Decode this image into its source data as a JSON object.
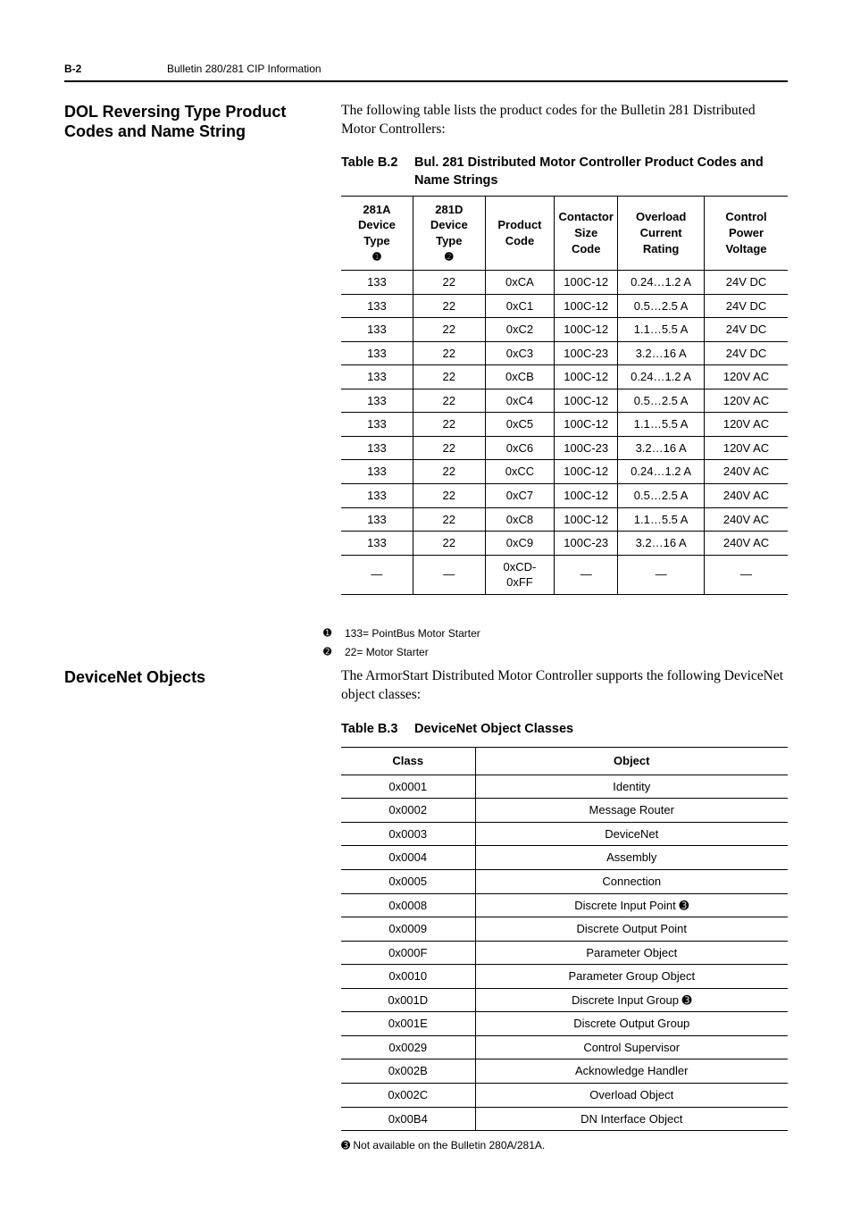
{
  "header": {
    "page": "B-2",
    "title": "Bulletin 280/281 CIP Information"
  },
  "section1": {
    "heading": "DOL Reversing Type Product Codes and Name String",
    "intro": "The following table lists the product codes for the Bulletin 281 Distributed Motor Controllers:",
    "tableCaptionNum": "Table B.2",
    "tableCaptionTxt": "Bul. 281 Distributed Motor Controller Product Codes and Name Strings",
    "headers": {
      "c0a": "281A",
      "c0b": "Device Type",
      "c0c": "➊",
      "c1a": "281D",
      "c1b": "Device Type",
      "c1c": "➋",
      "c2a": "Product",
      "c2b": "Code",
      "c3a": "Contactor",
      "c3b": "Size Code",
      "c4a": "Overload",
      "c4b": "Current Rating",
      "c5a": "Control Power",
      "c5b": "Voltage"
    },
    "rows": [
      [
        "133",
        "22",
        "0xCA",
        "100C-12",
        "0.24…1.2 A",
        "24V DC"
      ],
      [
        "133",
        "22",
        "0xC1",
        "100C-12",
        "0.5…2.5 A",
        "24V DC"
      ],
      [
        "133",
        "22",
        "0xC2",
        "100C-12",
        "1.1…5.5 A",
        "24V DC"
      ],
      [
        "133",
        "22",
        "0xC3",
        "100C-23",
        "3.2…16 A",
        "24V DC"
      ],
      [
        "133",
        "22",
        "0xCB",
        "100C-12",
        "0.24…1.2 A",
        "120V AC"
      ],
      [
        "133",
        "22",
        "0xC4",
        "100C-12",
        "0.5…2.5 A",
        "120V AC"
      ],
      [
        "133",
        "22",
        "0xC5",
        "100C-12",
        "1.1…5.5 A",
        "120V AC"
      ],
      [
        "133",
        "22",
        "0xC6",
        "100C-23",
        "3.2…16 A",
        "120V AC"
      ],
      [
        "133",
        "22",
        "0xCC",
        "100C-12",
        "0.24…1.2 A",
        "240V AC"
      ],
      [
        "133",
        "22",
        "0xC7",
        "100C-12",
        "0.5…2.5 A",
        "240V AC"
      ],
      [
        "133",
        "22",
        "0xC8",
        "100C-12",
        "1.1…5.5 A",
        "240V AC"
      ],
      [
        "133",
        "22",
        "0xC9",
        "100C-23",
        "3.2…16 A",
        "240V AC"
      ],
      [
        "—",
        "—",
        "0xCD-0xFF",
        "—",
        "—",
        "—"
      ]
    ],
    "fn1mark": "➊",
    "fn1text": "133= PointBus Motor Starter",
    "fn2mark": "➋",
    "fn2text": "22= Motor Starter"
  },
  "section2": {
    "heading": "DeviceNet Objects",
    "intro": "The ArmorStart Distributed Motor Controller supports the following DeviceNet object classes:",
    "tableCaptionNum": "Table B.3",
    "tableCaptionTxt": "DeviceNet Object Classes",
    "headers": {
      "c0": "Class",
      "c1": "Object"
    },
    "rows": [
      [
        "0x0001",
        "Identity"
      ],
      [
        "0x0002",
        "Message Router"
      ],
      [
        "0x0003",
        "DeviceNet"
      ],
      [
        "0x0004",
        "Assembly"
      ],
      [
        "0x0005",
        "Connection"
      ],
      [
        "0x0008",
        "Discrete Input Point ➌"
      ],
      [
        "0x0009",
        "Discrete Output Point"
      ],
      [
        "0x000F",
        "Parameter Object"
      ],
      [
        "0x0010",
        "Parameter Group Object"
      ],
      [
        "0x001D",
        "Discrete Input Group ➌"
      ],
      [
        "0x001E",
        "Discrete Output Group"
      ],
      [
        "0x0029",
        "Control Supervisor"
      ],
      [
        "0x002B",
        "Acknowledge Handler"
      ],
      [
        "0x002C",
        "Overload Object"
      ],
      [
        "0x00B4",
        "DN Interface Object"
      ]
    ],
    "footnote": "➌ Not available on the Bulletin 280A/281A."
  }
}
